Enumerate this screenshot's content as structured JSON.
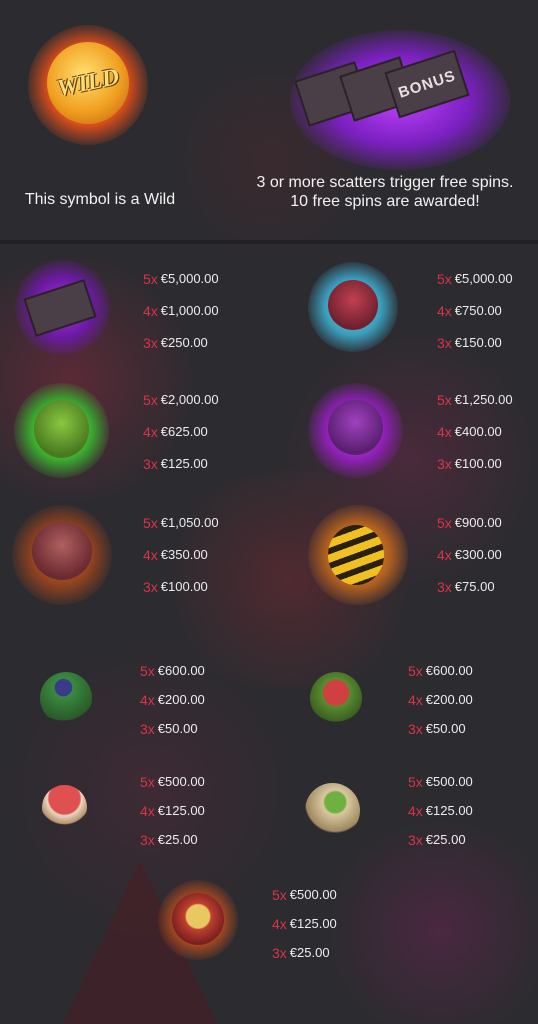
{
  "header": {
    "wild_description": "This symbol is a Wild",
    "scatter_description": "3 or more scatters trigger free spins. 10 free spins are awarded!",
    "wild_symbol_text": "WILD",
    "bonus_symbol_text": "BONUS"
  },
  "paytable": [
    {
      "symbol": "bonus-scatter",
      "payouts": [
        {
          "mult": "5x",
          "amount": "€5,000.00"
        },
        {
          "mult": "4x",
          "amount": "€1,000.00"
        },
        {
          "mult": "3x",
          "amount": "€250.00"
        }
      ]
    },
    {
      "symbol": "blue-monster",
      "payouts": [
        {
          "mult": "5x",
          "amount": "€5,000.00"
        },
        {
          "mult": "4x",
          "amount": "€750.00"
        },
        {
          "mult": "3x",
          "amount": "€150.00"
        }
      ]
    },
    {
      "symbol": "green-frog-monster",
      "payouts": [
        {
          "mult": "5x",
          "amount": "€2,000.00"
        },
        {
          "mult": "4x",
          "amount": "€625.00"
        },
        {
          "mult": "3x",
          "amount": "€125.00"
        }
      ]
    },
    {
      "symbol": "purple-bat-monster",
      "payouts": [
        {
          "mult": "5x",
          "amount": "€1,250.00"
        },
        {
          "mult": "4x",
          "amount": "€400.00"
        },
        {
          "mult": "3x",
          "amount": "€100.00"
        }
      ]
    },
    {
      "symbol": "spider",
      "payouts": [
        {
          "mult": "5x",
          "amount": "€1,050.00"
        },
        {
          "mult": "4x",
          "amount": "€350.00"
        },
        {
          "mult": "3x",
          "amount": "€100.00"
        }
      ]
    },
    {
      "symbol": "wasp",
      "payouts": [
        {
          "mult": "5x",
          "amount": "€900.00"
        },
        {
          "mult": "4x",
          "amount": "€300.00"
        },
        {
          "mult": "3x",
          "amount": "€75.00"
        }
      ]
    },
    {
      "symbol": "berry-plant",
      "payouts": [
        {
          "mult": "5x",
          "amount": "€600.00"
        },
        {
          "mult": "4x",
          "amount": "€200.00"
        },
        {
          "mult": "3x",
          "amount": "€50.00"
        }
      ]
    },
    {
      "symbol": "venus-flytrap",
      "payouts": [
        {
          "mult": "5x",
          "amount": "€600.00"
        },
        {
          "mult": "4x",
          "amount": "€200.00"
        },
        {
          "mult": "3x",
          "amount": "€50.00"
        }
      ]
    },
    {
      "symbol": "red-mushroom",
      "payouts": [
        {
          "mult": "5x",
          "amount": "€500.00"
        },
        {
          "mult": "4x",
          "amount": "€125.00"
        },
        {
          "mult": "3x",
          "amount": "€25.00"
        }
      ]
    },
    {
      "symbol": "mandrake-root",
      "payouts": [
        {
          "mult": "5x",
          "amount": "€500.00"
        },
        {
          "mult": "4x",
          "amount": "€125.00"
        },
        {
          "mult": "3x",
          "amount": "€25.00"
        }
      ]
    },
    {
      "symbol": "eyeball-fruit",
      "payouts": [
        {
          "mult": "5x",
          "amount": "€500.00"
        },
        {
          "mult": "4x",
          "amount": "€125.00"
        },
        {
          "mult": "3x",
          "amount": "€25.00"
        }
      ]
    }
  ],
  "colors": {
    "multiplier": "#d8344a",
    "amount": "#ececec",
    "background": "#2c2b30"
  }
}
